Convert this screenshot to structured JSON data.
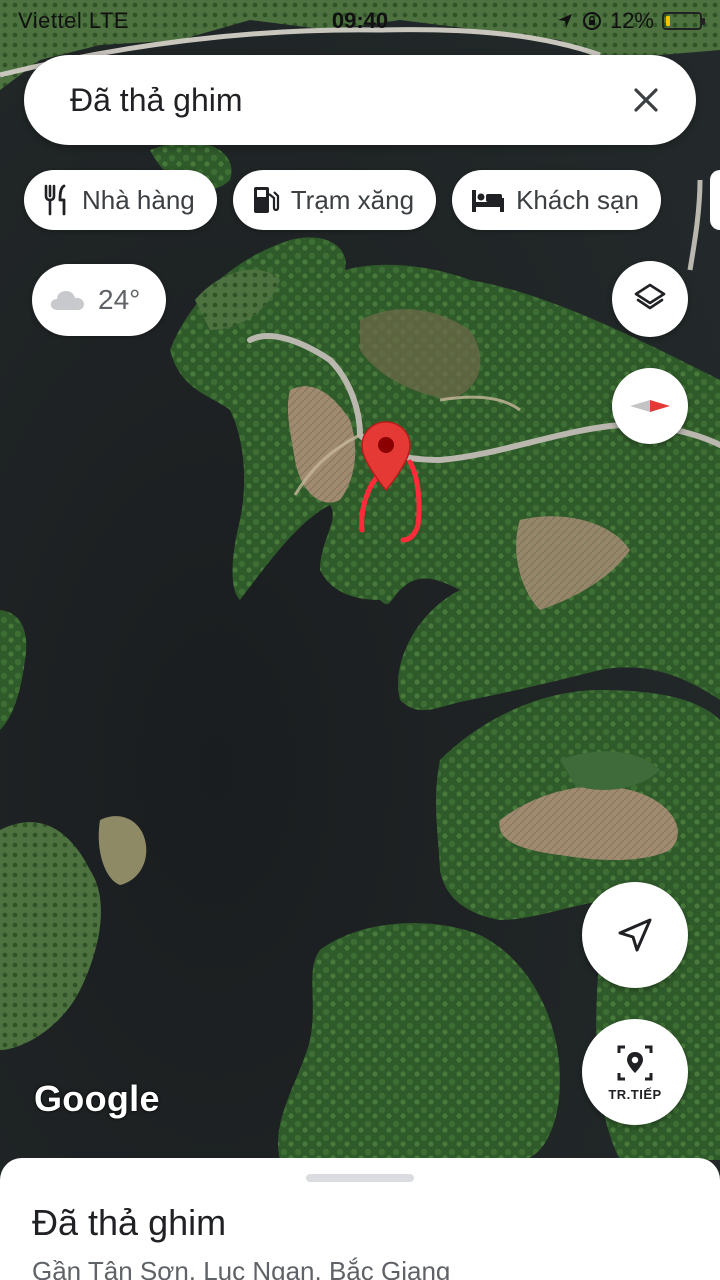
{
  "status_bar": {
    "carrier": "Viettel  LTE",
    "time": "09:40",
    "battery": "12%",
    "battery_level": 0.12,
    "icons": [
      "signal-icon",
      "location-arrow-icon",
      "rotation-lock-icon",
      "battery-icon"
    ]
  },
  "search": {
    "title": "Đã thả ghim",
    "close_icon": "close-icon"
  },
  "chips": [
    {
      "label": "Nhà hàng",
      "icon": "restaurant-icon"
    },
    {
      "label": "Trạm xăng",
      "icon": "gas-station-icon"
    },
    {
      "label": "Khách sạn",
      "icon": "hotel-icon"
    }
  ],
  "weather": {
    "temp": "24°",
    "icon": "cloud-icon"
  },
  "map_controls": {
    "layers_icon": "layers-icon",
    "compass_icon": "compass-icon",
    "my_location_icon": "navigation-arrow-icon",
    "live_view_label": "TR.TIẾP",
    "live_view_icon": "live-view-pin-icon"
  },
  "map": {
    "attribution": "Google",
    "pin_color": "#e53935",
    "annotation_color": "#ff2b3a"
  },
  "bottom_sheet": {
    "title": "Đã thả ghim",
    "subtitle": "Gần Tân Sơn, Lục Ngạn, Bắc Giang"
  }
}
